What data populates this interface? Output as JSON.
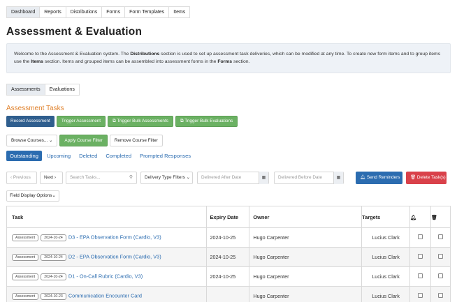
{
  "nav": {
    "tabs": [
      {
        "label": "Dashboard",
        "active": true
      },
      {
        "label": "Reports"
      },
      {
        "label": "Distributions"
      },
      {
        "label": "Forms"
      },
      {
        "label": "Form Templates"
      },
      {
        "label": "Items"
      }
    ]
  },
  "page": {
    "title": "Assessment & Evaluation"
  },
  "welcome": {
    "part1": "Welcome to the Assessment & Evaluation system. The ",
    "b1": "Distributions",
    "part2": " section is used to set up assessment task deliveries, which can be modified at any time. To create new form items and to group items use the ",
    "b2": "Items",
    "part3": " section. Items and grouped items can be assembled into assessment forms in the ",
    "b3": "Forms",
    "part4": " section."
  },
  "subtabs": [
    {
      "label": "Assessments",
      "active": true
    },
    {
      "label": "Evaluations"
    }
  ],
  "section": {
    "title": "Assessment Tasks"
  },
  "actions": {
    "record": "Record Assessment",
    "trigger": "Trigger Assessment",
    "trigger_bulk": "Trigger Bulk Assessments",
    "trigger_bulk_eval": "Trigger Bulk Evaluations"
  },
  "filters": {
    "browse": "Browse Courses...",
    "apply": "Apply Course Filter",
    "remove": "Remove Course Filter"
  },
  "status_tabs": [
    {
      "label": "Outstanding",
      "active": true
    },
    {
      "label": "Upcoming"
    },
    {
      "label": "Deleted"
    },
    {
      "label": "Completed"
    },
    {
      "label": "Prompted Responses"
    }
  ],
  "toolbar": {
    "previous": "Previous",
    "next": "Next",
    "search_placeholder": "Search Tasks...",
    "delivery_filter": "Delivery Type Filters",
    "after_placeholder": "Delivered After Date",
    "before_placeholder": "Delivered Before Date",
    "send_reminders": "Send Reminders",
    "delete_tasks": "Delete Task(s)"
  },
  "field_display": "Field Display Options",
  "table": {
    "headers": {
      "task": "Task",
      "expiry": "Expiry Date",
      "owner": "Owner",
      "targets": "Targets"
    },
    "rows": [
      {
        "type": "Assessment",
        "date": "2024-10-24",
        "title": "D3 - EPA Observation Form (Cardio, V3)",
        "expiry": "2024-10-25",
        "owner": "Hugo Carpenter",
        "target": "Lucius Clark"
      },
      {
        "type": "Assessment",
        "date": "2024-10-24",
        "title": "D2 - EPA Observation Form (Cardio, V3)",
        "expiry": "2024-10-25",
        "owner": "Hugo Carpenter",
        "target": "Lucius Clark"
      },
      {
        "type": "Assessment",
        "date": "2024-10-24",
        "title": "D1 - On-Call Rubric (Cardio, V3)",
        "expiry": "2024-10-25",
        "owner": "Hugo Carpenter",
        "target": "Lucius Clark"
      },
      {
        "type": "Assessment",
        "date": "2024-10-23",
        "title": "Communication Encounter Card",
        "expiry": "",
        "owner": "Hugo Carpenter",
        "target": "Lucius Clark"
      }
    ]
  }
}
